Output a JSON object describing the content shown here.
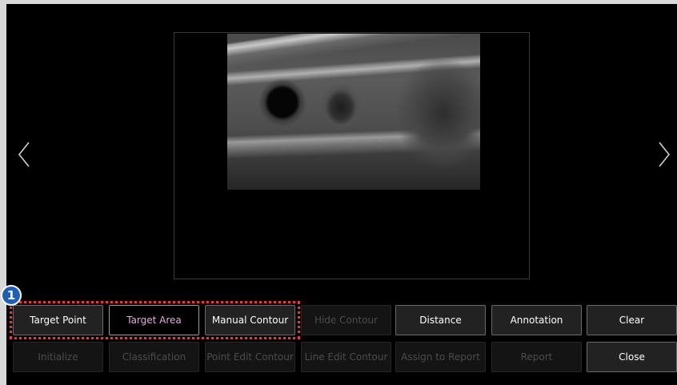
{
  "callout": {
    "number": "1"
  },
  "toolbar": {
    "row1": [
      {
        "label": "Target Point",
        "state": "active"
      },
      {
        "label": "Target Area",
        "state": "selected"
      },
      {
        "label": "Manual Contour",
        "state": "active"
      },
      {
        "label": "Hide Contour",
        "state": "disabled"
      },
      {
        "label": "Distance",
        "state": "active"
      },
      {
        "label": "Annotation",
        "state": "active"
      },
      {
        "label": "Clear",
        "state": "active"
      }
    ],
    "row2": [
      {
        "label": "Initialize",
        "state": "disabled"
      },
      {
        "label": "Classification",
        "state": "disabled"
      },
      {
        "label": "Point Edit Contour",
        "state": "disabled"
      },
      {
        "label": "Line Edit Contour",
        "state": "disabled"
      },
      {
        "label": "Assign to Report",
        "state": "disabled"
      },
      {
        "label": "Report",
        "state": "disabled"
      },
      {
        "label": "Close",
        "state": "active"
      }
    ]
  },
  "colors": {
    "selected_text": "#e9a6e2",
    "highlight_border": "#e33c3c",
    "callout_bg": "#1f5fb5"
  },
  "icons": {
    "prev": "chevron-left-icon",
    "next": "chevron-right-icon"
  }
}
